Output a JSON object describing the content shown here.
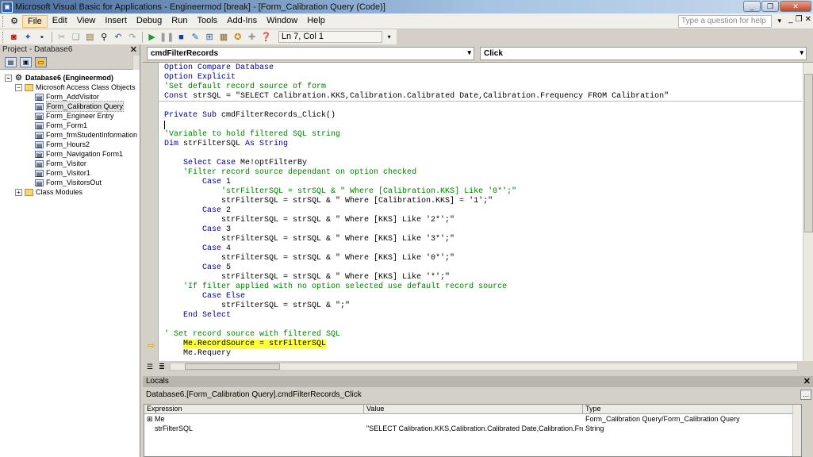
{
  "window": {
    "title": "Microsoft Visual Basic for Applications - Engineermod [break] - [Form_Calibration Query (Code)]",
    "controls": [
      "minimize",
      "restore",
      "close"
    ]
  },
  "menubar": {
    "items": [
      {
        "label": "File",
        "active": true
      },
      {
        "label": "Edit"
      },
      {
        "label": "View"
      },
      {
        "label": "Insert"
      },
      {
        "label": "Debug"
      },
      {
        "label": "Run"
      },
      {
        "label": "Tools"
      },
      {
        "label": "Add-Ins"
      },
      {
        "label": "Window"
      },
      {
        "label": "Help"
      }
    ],
    "help_placeholder": "Type a question for help"
  },
  "toolbar": {
    "position": "Ln 7, Col 1"
  },
  "project": {
    "title": "Project - Database6",
    "tree": [
      {
        "label": "Database6 (Engineermod)",
        "level": 0,
        "expander": "−",
        "icon": "db",
        "bold": true
      },
      {
        "label": "Microsoft Access Class Objects",
        "level": 1,
        "expander": "−",
        "icon": "folder"
      },
      {
        "label": "Form_AddVisitor",
        "level": 2,
        "icon": "form"
      },
      {
        "label": "Form_Calibration Query",
        "level": 2,
        "icon": "form",
        "selected": true
      },
      {
        "label": "Form_Engineer Entry",
        "level": 2,
        "icon": "form"
      },
      {
        "label": "Form_Form1",
        "level": 2,
        "icon": "form"
      },
      {
        "label": "Form_frmStudentInformation",
        "level": 2,
        "icon": "form"
      },
      {
        "label": "Form_Hours2",
        "level": 2,
        "icon": "form"
      },
      {
        "label": "Form_Navigation Form1",
        "level": 2,
        "icon": "form"
      },
      {
        "label": "Form_Visitor",
        "level": 2,
        "icon": "form"
      },
      {
        "label": "Form_Visitor1",
        "level": 2,
        "icon": "form"
      },
      {
        "label": "Form_VisitorsOut",
        "level": 2,
        "icon": "form"
      },
      {
        "label": "Class Modules",
        "level": 1,
        "expander": "+",
        "icon": "folder"
      }
    ]
  },
  "code": {
    "object": "cmdFilterRecords",
    "procedure": "Click",
    "lines": [
      [
        [
          "k",
          "Option Compare Database"
        ]
      ],
      [
        [
          "k",
          "Option Explicit"
        ]
      ],
      [
        [
          "c",
          "'Set default record source of form"
        ]
      ],
      [
        [
          "k",
          "Const "
        ],
        [
          "t",
          "strSQL = \"SELECT Calibration.KKS,Calibration.Calibrated Date,Calibration.Frequency FROM Calibration\""
        ]
      ],
      [],
      [
        [
          "k",
          "Private Sub "
        ],
        [
          "t",
          "cmdFilterRecords_Click()"
        ]
      ],
      [],
      [
        [
          "c",
          "'Variable to hold filtered SQL string"
        ]
      ],
      [
        [
          "k",
          "Dim "
        ],
        [
          "t",
          "strFilterSQL "
        ],
        [
          "k",
          "As String"
        ]
      ],
      [],
      [
        [
          "t",
          "    "
        ],
        [
          "k",
          "Select Case "
        ],
        [
          "t",
          "Me!optFilterBy"
        ]
      ],
      [
        [
          "t",
          "    "
        ],
        [
          "c",
          "'Filter record source dependant on option checked"
        ]
      ],
      [
        [
          "t",
          "        "
        ],
        [
          "k",
          "Case "
        ],
        [
          "t",
          "1"
        ]
      ],
      [
        [
          "t",
          "            "
        ],
        [
          "c",
          "'strFilterSQL = strSQL & \" Where [Calibration.KKS] Like '0*';\""
        ]
      ],
      [
        [
          "t",
          "            strFilterSQL = strSQL & \" Where [Calibration.KKS] = '1';\""
        ]
      ],
      [
        [
          "t",
          "        "
        ],
        [
          "k",
          "Case "
        ],
        [
          "t",
          "2"
        ]
      ],
      [
        [
          "t",
          "            strFilterSQL = strSQL & \" Where [KKS] Like '2*';\""
        ]
      ],
      [
        [
          "t",
          "        "
        ],
        [
          "k",
          "Case "
        ],
        [
          "t",
          "3"
        ]
      ],
      [
        [
          "t",
          "            strFilterSQL = strSQL & \" Where [KKS] Like '3*';\""
        ]
      ],
      [
        [
          "t",
          "        "
        ],
        [
          "k",
          "Case "
        ],
        [
          "t",
          "4"
        ]
      ],
      [
        [
          "t",
          "            strFilterSQL = strSQL & \" Where [KKS] Like '0*';\""
        ]
      ],
      [
        [
          "t",
          "        "
        ],
        [
          "k",
          "Case "
        ],
        [
          "t",
          "5"
        ]
      ],
      [
        [
          "t",
          "            strFilterSQL = strSQL & \" Where [KKS] Like '*';\""
        ]
      ],
      [
        [
          "t",
          "    "
        ],
        [
          "c",
          "'If filter applied with no option selected use default record source"
        ]
      ],
      [
        [
          "t",
          "        "
        ],
        [
          "k",
          "Case Else"
        ]
      ],
      [
        [
          "t",
          "            strFilterSQL = strSQL & \";\""
        ]
      ],
      [
        [
          "t",
          "    "
        ],
        [
          "k",
          "End Select"
        ]
      ],
      [],
      [
        [
          "c",
          "' Set record source with filtered SQL"
        ]
      ],
      [
        [
          "t",
          "    "
        ],
        [
          "hl",
          "Me.RecordSource = strFilterSQL"
        ]
      ],
      [
        [
          "t",
          "    Me.Requery"
        ]
      ]
    ]
  },
  "locals": {
    "title": "Locals",
    "context": "Database6.[Form_Calibration Query].cmdFilterRecords_Click",
    "columns": [
      "Expression",
      "Value",
      "Type"
    ],
    "rows": [
      {
        "expression": "Me",
        "value": "",
        "type": "Form_Calibration Query/Form_Calibration Query",
        "expander": "+"
      },
      {
        "expression": "strFilterSQL",
        "value": "\"SELECT Calibration.KKS,Calibration.Calibrated Date,Calibration.Frequency F",
        "type": "String"
      }
    ]
  }
}
